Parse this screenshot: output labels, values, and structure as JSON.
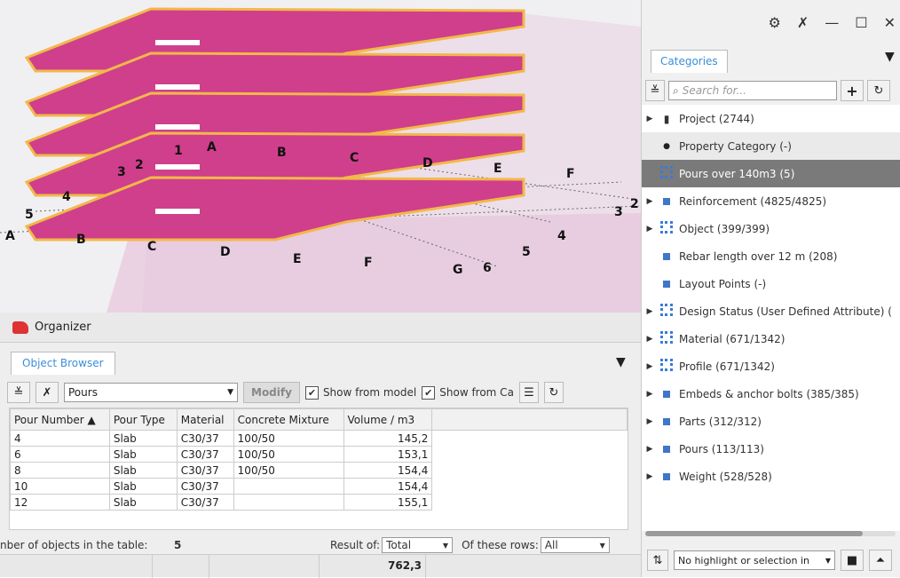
{
  "viewport": {
    "grid_labels": [
      "A",
      "B",
      "C",
      "D",
      "E",
      "F",
      "G",
      "1",
      "2",
      "3",
      "4",
      "5",
      "6"
    ]
  },
  "organizer": {
    "title": "Organizer",
    "tab": "Object Browser",
    "query": "Pours",
    "modify": "Modify",
    "show_model": "Show from model",
    "show_ca": "Show from Ca",
    "columns": [
      "Pour Number ▲",
      "Pour Type",
      "Material",
      "Concrete Mixture",
      "Volume / m3"
    ],
    "rows": [
      [
        "4",
        "Slab",
        "C30/37",
        "100/50",
        "145,2"
      ],
      [
        "6",
        "Slab",
        "C30/37",
        "100/50",
        "153,1"
      ],
      [
        "8",
        "Slab",
        "C30/37",
        "100/50",
        "154,4"
      ],
      [
        "10",
        "Slab",
        "C30/37",
        "",
        "154,4"
      ],
      [
        "12",
        "Slab",
        "C30/37",
        "",
        "155,1"
      ]
    ],
    "status_label": "nber of objects in the table:",
    "status_count": "5",
    "result_label": "Result of:",
    "result_value": "Total",
    "rows_label": "Of these rows:",
    "rows_value": "All",
    "total": "762,3"
  },
  "categories": {
    "tab": "Categories",
    "search_placeholder": "Search for...",
    "items": [
      {
        "label": "Project (2744)",
        "tri": "▶"
      },
      {
        "label": "Property Category (-)",
        "tri": ""
      },
      {
        "label": "Pours over 140m3 (5)",
        "tri": ""
      },
      {
        "label": "Reinforcement (4825/4825)",
        "tri": "▶"
      },
      {
        "label": "Object (399/399)",
        "tri": "▶"
      },
      {
        "label": "Rebar length over 12 m (208)",
        "tri": ""
      },
      {
        "label": "Layout Points (-)",
        "tri": ""
      },
      {
        "label": "Design Status (User Defined Attribute) (",
        "tri": "▶"
      },
      {
        "label": "Material (671/1342)",
        "tri": "▶"
      },
      {
        "label": "Profile (671/1342)",
        "tri": "▶"
      },
      {
        "label": "Embeds & anchor bolts (385/385)",
        "tri": "▶"
      },
      {
        "label": "Parts (312/312)",
        "tri": "▶"
      },
      {
        "label": "Pours (113/113)",
        "tri": "▶"
      },
      {
        "label": "Weight (528/528)",
        "tri": "▶"
      }
    ],
    "highlight": "No highlight or selection in"
  }
}
